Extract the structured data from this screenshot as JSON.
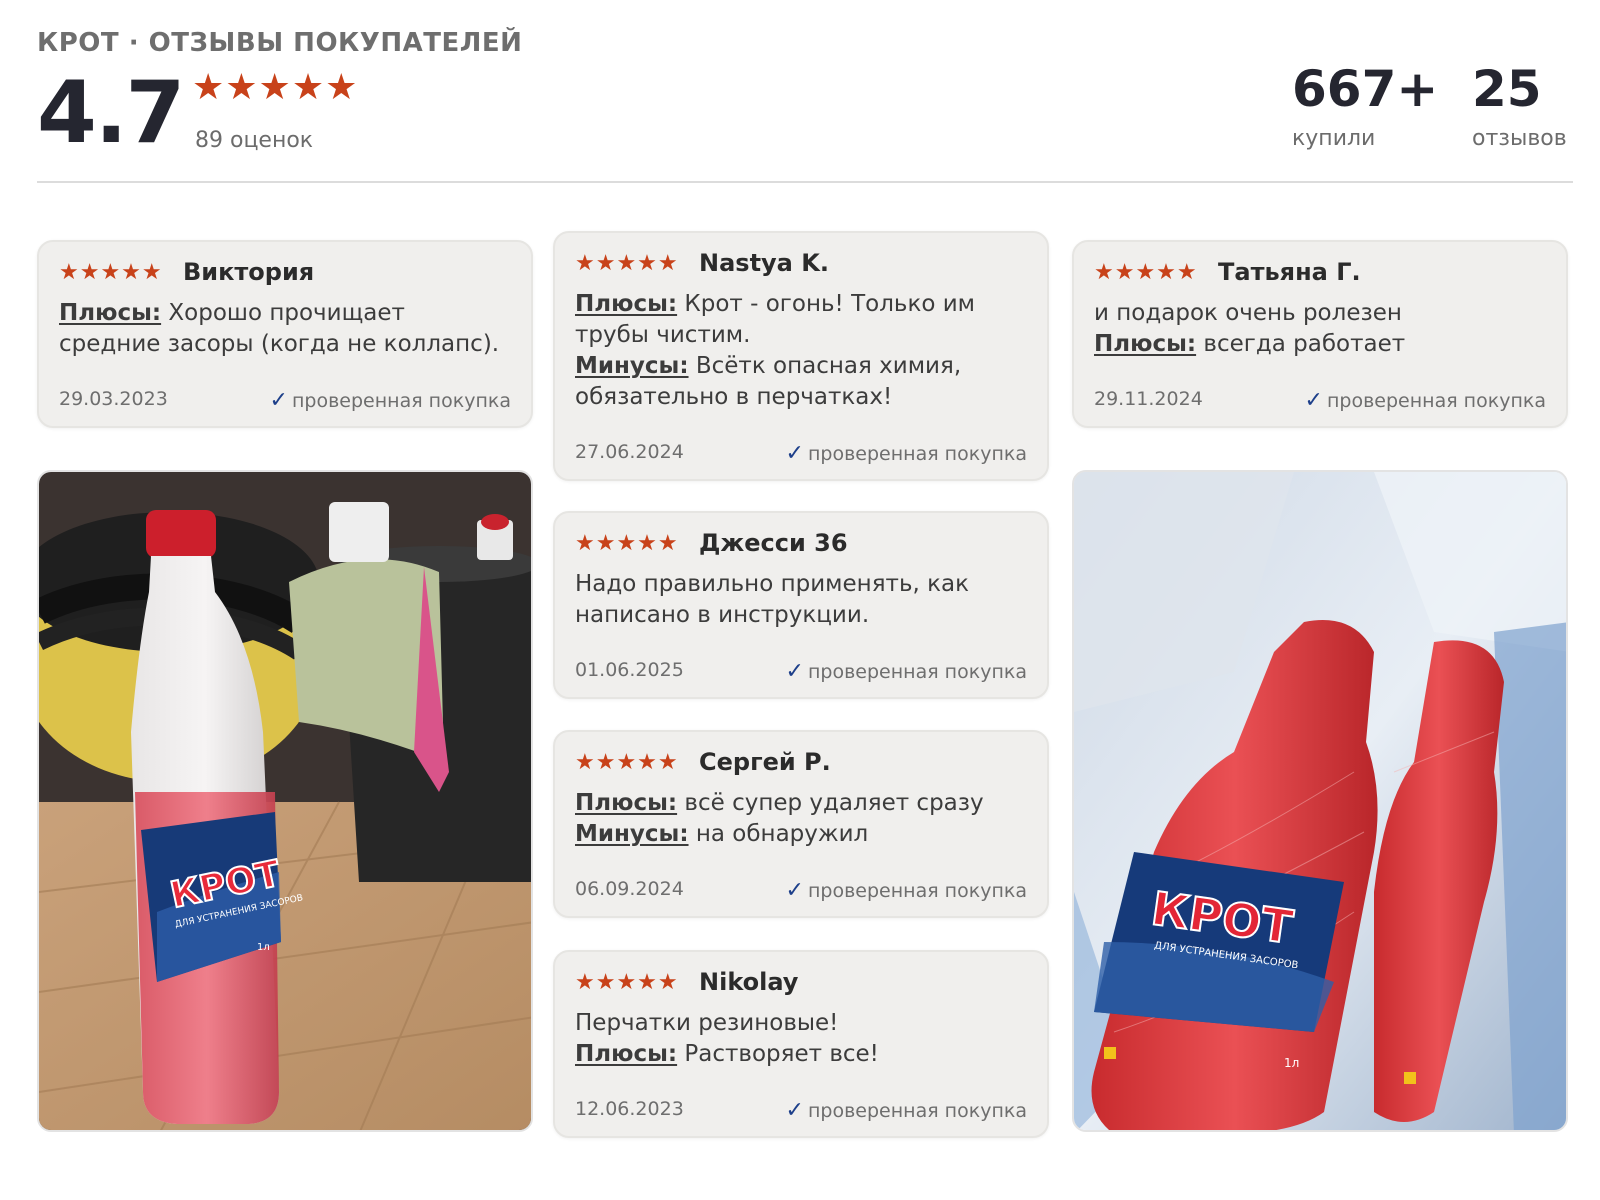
{
  "header": {
    "title": "КРОТ · ОТЗЫВЫ ПОКУПАТЕЛЕЙ",
    "rating": "4.7",
    "stars": "★★★★★",
    "rating_count": "89 оценок",
    "bought_num": "667+",
    "bought_label": "купили",
    "reviews_num": "25",
    "reviews_label": "отзывов"
  },
  "colors": {
    "star": "#c8421a",
    "check": "#1d3f8a",
    "card_bg": "#f0efed"
  },
  "reviews": [
    {
      "stars": "★★★★★",
      "author": "Виктория",
      "pros_label": "Плюсы:",
      "pros": " Хорошо прочищает средние засоры (когда не коллапс).",
      "date": "29.03.2023",
      "verified": "проверенная покупка"
    },
    {
      "stars": "★★★★★",
      "author": "Nastya K.",
      "pros_label": "Плюсы:",
      "pros": " Крот - огонь! Только им трубы чистим.",
      "cons_label": "Минусы:",
      "cons": " Всётк опасная химия, обязательно в перчатках!",
      "date": "27.06.2024",
      "verified": "проверенная покупка"
    },
    {
      "stars": "★★★★★",
      "author": "Татьяна Г.",
      "comment": "и подарок очень ролезен",
      "pros_label": "Плюсы:",
      "pros": " всегда работает",
      "date": "29.11.2024",
      "verified": "проверенная покупка"
    },
    {
      "stars": "★★★★★",
      "author": "Джесси 36",
      "comment": "Надо правильно применять, как написано в инструкции.",
      "date": "01.06.2025",
      "verified": "проверенная покупка"
    },
    {
      "stars": "★★★★★",
      "author": "Сергей Р.",
      "pros_label": "Плюсы:",
      "pros": " всё супер удаляет сразу",
      "cons_label": "Минусы:",
      "cons": " на обнаружил",
      "date": "06.09.2024",
      "verified": "проверенная покупка"
    },
    {
      "stars": "★★★★★",
      "author": "Nikolay",
      "comment": "Перчатки резиновые!",
      "pros_label": "Плюсы:",
      "pros": " Растворяет все!",
      "date": "12.06.2023",
      "verified": "проверенная покупка"
    }
  ],
  "photos": {
    "left": {
      "bottle_brand": "КРОТ",
      "bottle_sub": "ДЛЯ УСТРАНЕНИЯ ЗАСОРОВ",
      "volume": "1л"
    },
    "right": {
      "bottle_brand": "КРОТ",
      "bottle_sub": "ДЛЯ УСТРАНЕНИЯ ЗАСОРОВ",
      "volume": "1л"
    }
  }
}
